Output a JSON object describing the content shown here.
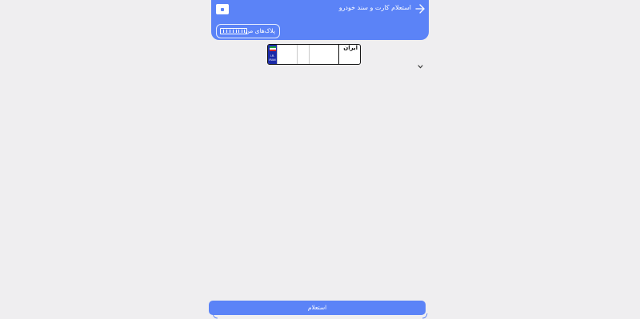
{
  "header": {
    "title": "استعلام کارت و سند خودرو",
    "back_icon": "arrow-right-icon",
    "menu_icon": "square-icon",
    "my_plates_label": "پلاک‌های من",
    "background_color": "#5b83f7"
  },
  "plate": {
    "country_label": "ایران",
    "flag_text_line1": "I.R.",
    "flag_text_line2": "IRAN",
    "flag_color": "#1b2aa8"
  },
  "dropdown": {
    "icon": "chevron-down-icon"
  },
  "submit": {
    "label": "استعلام",
    "color": "#5b83f7"
  }
}
